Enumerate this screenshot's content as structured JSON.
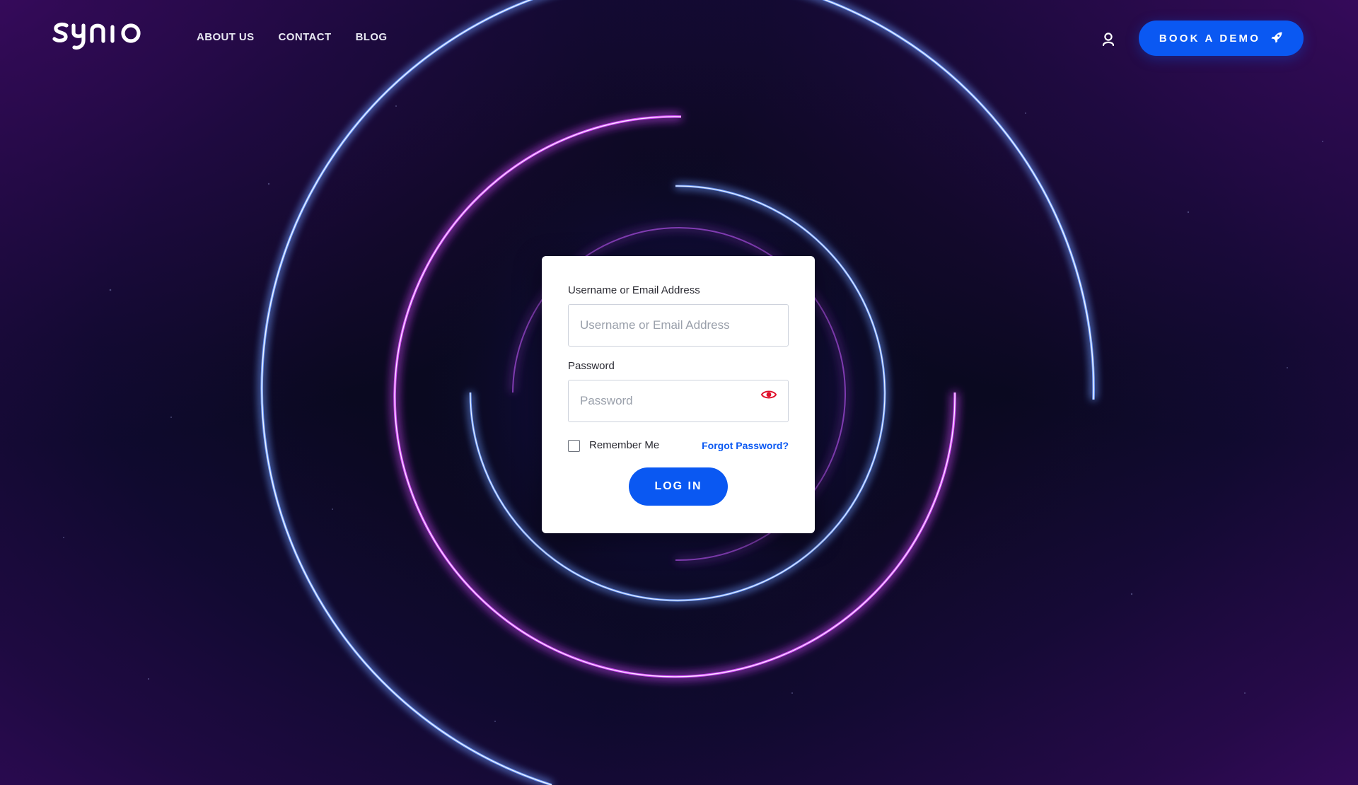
{
  "brand": {
    "logo_text": "synio"
  },
  "nav": {
    "items": [
      {
        "label": "ABOUT US"
      },
      {
        "label": "CONTACT"
      },
      {
        "label": "BLOG"
      }
    ]
  },
  "header": {
    "account_icon": "user-icon",
    "demo_button": {
      "label": "BOOK A DEMO",
      "icon": "rocket-icon"
    }
  },
  "login_form": {
    "username_label": "Username or Email Address",
    "username_placeholder": "Username or Email Address",
    "username_value": "",
    "password_label": "Password",
    "password_placeholder": "Password",
    "password_value": "",
    "show_password_icon": "eye-icon",
    "remember_label": "Remember Me",
    "remember_checked": false,
    "forgot_label": "Forgot Password?",
    "submit_label": "LOG IN"
  },
  "colors": {
    "accent": "#0a58f2",
    "ring_blue": "#5a8cff",
    "ring_magenta": "#d44dff",
    "eye_red": "#e0112b",
    "background": "#0b0a22"
  }
}
